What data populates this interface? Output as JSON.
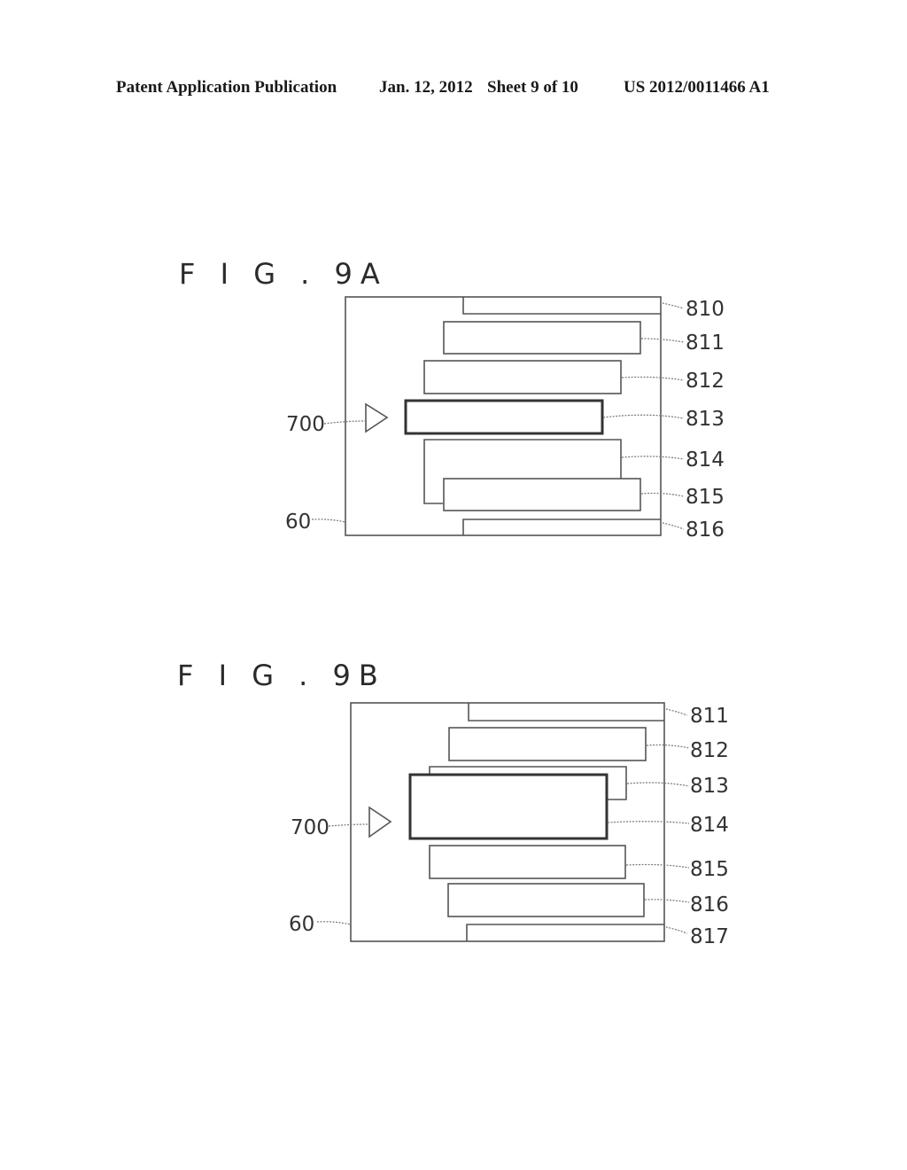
{
  "header": {
    "publication": "Patent Application Publication",
    "date": "Jan. 12, 2012",
    "sheet": "Sheet 9 of 10",
    "number": "US 2012/0011466 A1"
  },
  "figures": [
    {
      "title": "F I G . 9A",
      "labels": {
        "pointer": "700",
        "screen": "60",
        "items": [
          "810",
          "811",
          "812",
          "813",
          "814",
          "815",
          "816"
        ]
      },
      "selected_item": "813"
    },
    {
      "title": "F I G . 9B",
      "labels": {
        "pointer": "700",
        "screen": "60",
        "items": [
          "811",
          "812",
          "813",
          "814",
          "815",
          "816",
          "817"
        ]
      },
      "selected_item": "814"
    }
  ]
}
